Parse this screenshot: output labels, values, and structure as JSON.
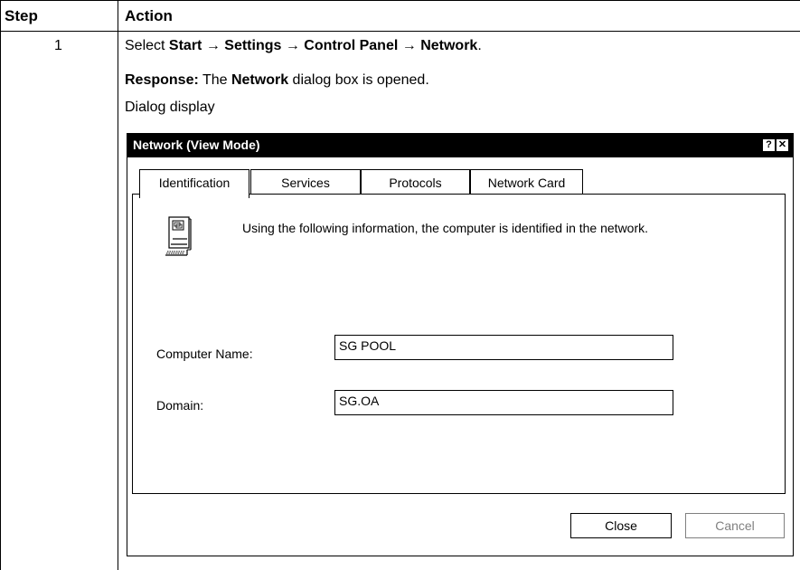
{
  "table": {
    "headers": {
      "step": "Step",
      "action": "Action"
    },
    "row": {
      "step": "1",
      "instruction": {
        "select": "Select ",
        "start": "Start",
        "arrow": " → ",
        "settings": "Settings",
        "control_panel": "Control Panel",
        "network": "Network",
        "period": "."
      },
      "response": {
        "label": "Response:",
        "pre": " The ",
        "network": "Network",
        "post": " dialog box is opened."
      },
      "display_label": "Dialog display"
    }
  },
  "dialog": {
    "title": "Network (View Mode)",
    "help_glyph": "?",
    "close_glyph": "✕",
    "tabs": [
      "Identification",
      "Services",
      "Protocols",
      "Network Card"
    ],
    "active_tab": 0,
    "info_text": "Using the following information, the computer is identified in the network.",
    "fields": {
      "computer_name_label": "Computer Name:",
      "computer_name_value": "SG POOL",
      "domain_label": "Domain:",
      "domain_value": "SG.OA"
    },
    "buttons": {
      "close": "Close",
      "cancel": "Cancel"
    },
    "disabled_color": "#808080"
  }
}
